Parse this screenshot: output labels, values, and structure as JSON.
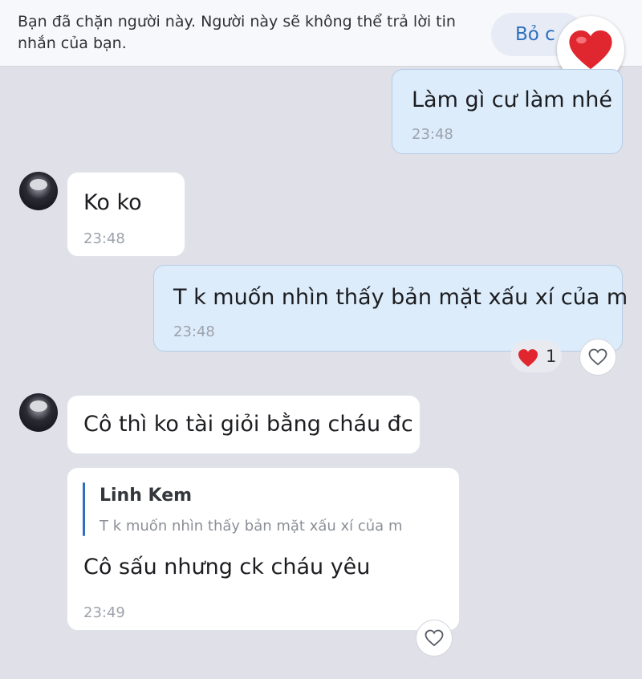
{
  "banner": {
    "notice": "Bạn đã chặn người này. Người này sẽ không thể trả lời tin nhắn của bạn.",
    "unblock_label": "Bỏ c"
  },
  "messages": [
    {
      "direction": "outgoing",
      "text": "Làm gì cư làm nhé",
      "time": "23:48"
    },
    {
      "direction": "incoming",
      "text": "Ko ko",
      "time": "23:48"
    },
    {
      "direction": "outgoing",
      "text": "T k muốn nhìn thấy bản mặt xấu xí của m",
      "time": "23:48",
      "reaction": {
        "icon": "heart-icon",
        "count": "1"
      }
    },
    {
      "direction": "incoming",
      "text": "Cô thì ko tài giỏi bằng cháu đc"
    },
    {
      "direction": "incoming",
      "quote": {
        "author": "Linh Kem",
        "text": "T k muốn nhìn thấy bản mặt xấu xí của m"
      },
      "text": "Cô sấu nhưng ck cháu yêu",
      "time": "23:49"
    }
  ],
  "colors": {
    "background": "#dfe0e8",
    "outgoing_bubble": "#dcecfb",
    "incoming_bubble": "#ffffff",
    "accent": "#2c6fc0",
    "reaction_heart": "#e0262f"
  }
}
